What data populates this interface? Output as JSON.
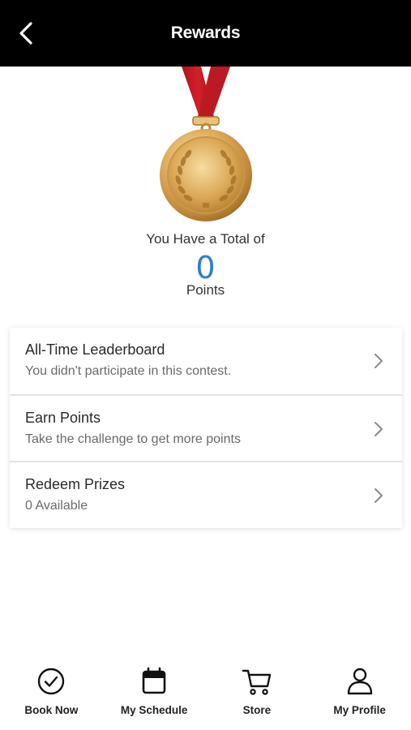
{
  "header": {
    "title": "Rewards",
    "back_icon": "chevron-left-icon"
  },
  "summary": {
    "total_label": "You Have a Total of",
    "points_value": "0",
    "points_label": "Points",
    "accent_color": "#2f7bd6",
    "medal_icon": "gold-medal-icon"
  },
  "menu": [
    {
      "title": "All-Time Leaderboard",
      "subtitle": "You didn't participate in this contest."
    },
    {
      "title": "Earn Points",
      "subtitle": "Take the challenge to get more points"
    },
    {
      "title": "Redeem Prizes",
      "subtitle": "0 Available"
    }
  ],
  "bottom_nav": [
    {
      "label": "Book Now",
      "icon": "check-circle-icon"
    },
    {
      "label": "My Schedule",
      "icon": "calendar-icon"
    },
    {
      "label": "Store",
      "icon": "cart-icon"
    },
    {
      "label": "My Profile",
      "icon": "person-icon"
    }
  ]
}
